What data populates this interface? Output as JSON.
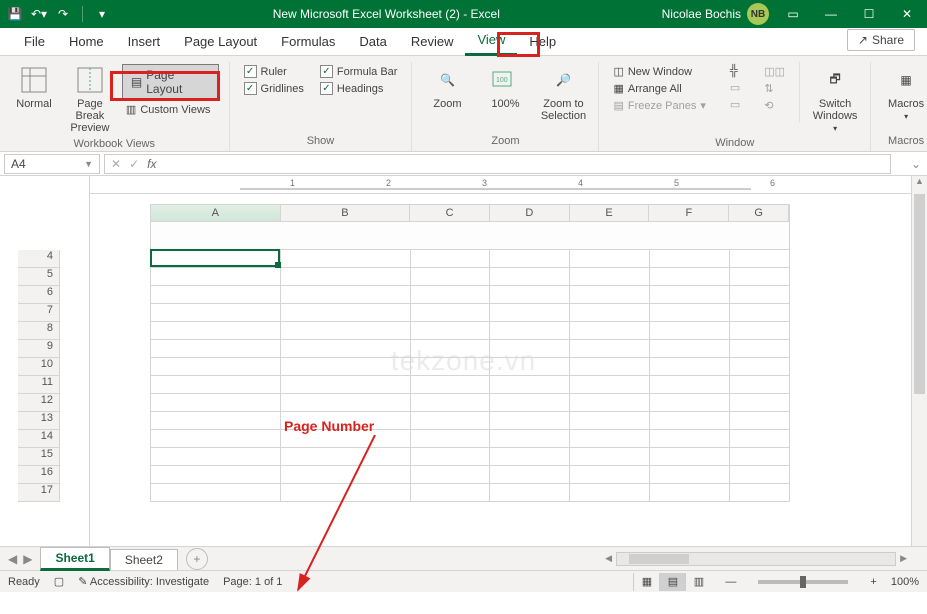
{
  "titlebar": {
    "title": "New Microsoft Excel Worksheet (2)  -  Excel",
    "user_name": "Nicolae Bochis",
    "user_initials": "NB"
  },
  "tabs": {
    "items": [
      "File",
      "Home",
      "Insert",
      "Page Layout",
      "Formulas",
      "Data",
      "Review",
      "View",
      "Help"
    ],
    "active": "View",
    "share": "Share"
  },
  "ribbon": {
    "workbook_views": {
      "label": "Workbook Views",
      "normal": "Normal",
      "page_break": "Page Break\nPreview",
      "page_layout": "Page Layout",
      "custom_views": "Custom Views"
    },
    "show": {
      "label": "Show",
      "ruler": "Ruler",
      "gridlines": "Gridlines",
      "formula_bar": "Formula Bar",
      "headings": "Headings"
    },
    "zoom_group": {
      "label": "Zoom",
      "zoom": "Zoom",
      "hundred": "100%",
      "zoom_selection": "Zoom to\nSelection"
    },
    "window": {
      "label": "Window",
      "new_window": "New Window",
      "arrange_all": "Arrange All",
      "freeze_panes": "Freeze Panes",
      "switch_windows": "Switch\nWindows"
    },
    "macros": {
      "label": "Macros",
      "macros": "Macros"
    }
  },
  "formula_bar": {
    "name_box": "A4",
    "fx": "fx"
  },
  "grid": {
    "columns": [
      "A",
      "B",
      "C",
      "D",
      "E",
      "F",
      "G"
    ],
    "rows": [
      "4",
      "5",
      "6",
      "7",
      "8",
      "9",
      "10",
      "11",
      "12",
      "13",
      "14",
      "15",
      "16",
      "17"
    ],
    "ruler_marks": [
      "1",
      "2",
      "3",
      "4",
      "5",
      "6"
    ]
  },
  "sheets": {
    "tabs": [
      "Sheet1",
      "Sheet2"
    ],
    "active": "Sheet1"
  },
  "status": {
    "ready": "Ready",
    "accessibility": "Accessibility: Investigate",
    "page": "Page: 1 of 1",
    "zoom": "100%"
  },
  "annotation": {
    "label": "Page Number"
  },
  "watermark": "tekzone.vn"
}
